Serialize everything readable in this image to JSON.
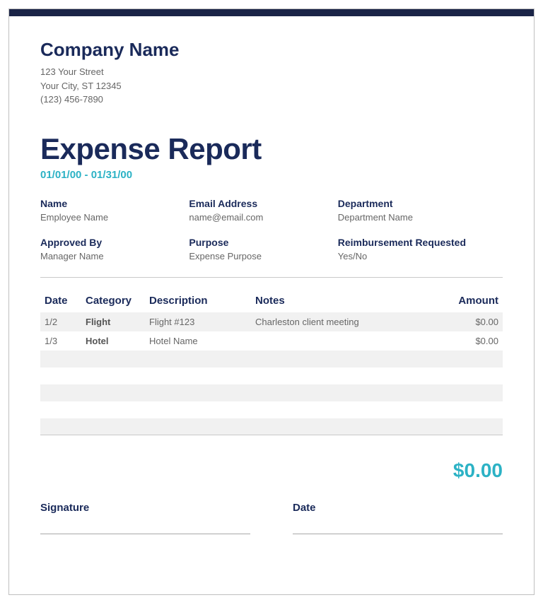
{
  "company": {
    "name": "Company Name",
    "street": "123 Your Street",
    "city_state_zip": "Your City, ST 12345",
    "phone": "(123) 456-7890"
  },
  "report": {
    "title": "Expense Report",
    "date_range": "01/01/00 - 01/31/00",
    "total": "$0.00"
  },
  "meta": {
    "row1": [
      {
        "label": "Name",
        "value": "Employee Name"
      },
      {
        "label": "Email Address",
        "value": "name@email.com"
      },
      {
        "label": "Department",
        "value": "Department Name"
      }
    ],
    "row2": [
      {
        "label": "Approved By",
        "value": "Manager Name"
      },
      {
        "label": "Purpose",
        "value": "Expense Purpose"
      },
      {
        "label": "Reimbursement Requested",
        "value": "Yes/No"
      }
    ]
  },
  "table": {
    "headers": {
      "date": "Date",
      "category": "Category",
      "description": "Description",
      "notes": "Notes",
      "amount": "Amount"
    },
    "rows": [
      {
        "date": "1/2",
        "category": "Flight",
        "description": "Flight #123",
        "notes": "Charleston client meeting",
        "amount": "$0.00"
      },
      {
        "date": "1/3",
        "category": "Hotel",
        "description": "Hotel Name",
        "notes": "",
        "amount": "$0.00"
      }
    ]
  },
  "signature": {
    "signature_label": "Signature",
    "date_label": "Date"
  }
}
